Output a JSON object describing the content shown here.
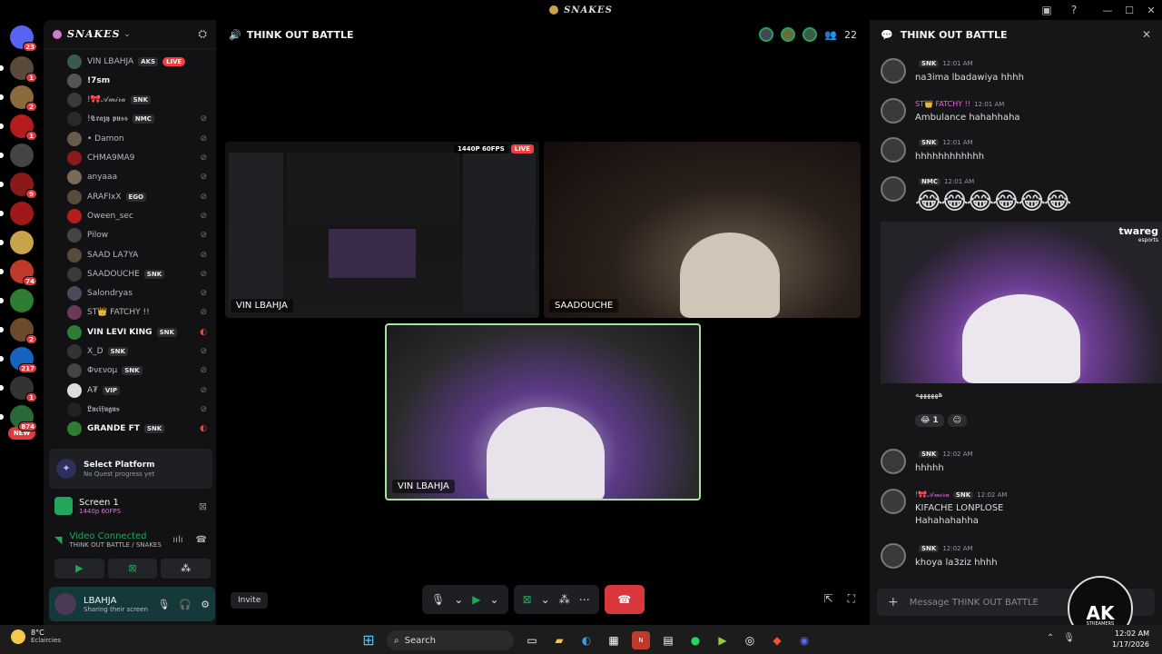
{
  "window": {
    "title": "SNAKES"
  },
  "rail": {
    "home_badge": "23",
    "servers": [
      {
        "color": "#5a4a3a",
        "badge": "1"
      },
      {
        "color": "#8a6a3a",
        "badge": "2"
      },
      {
        "color": "#b71c1c",
        "badge": "1"
      },
      {
        "color": "#444444",
        "badge": ""
      },
      {
        "color": "#8a1a1a",
        "badge": "9"
      },
      {
        "color": "#a01818",
        "badge": ""
      },
      {
        "color": "#c9a34a",
        "badge": ""
      },
      {
        "color": "#c0392b",
        "badge": "74"
      },
      {
        "color": "#2e7d32",
        "badge": ""
      },
      {
        "color": "#6a4a2a",
        "badge": "2"
      },
      {
        "color": "#1565c0",
        "badge": "217"
      },
      {
        "color": "#333333",
        "badge": "1"
      },
      {
        "color": "#2a6a3a",
        "badge": "874"
      }
    ],
    "new_label": "NEW"
  },
  "sidebar": {
    "server_name": "SNAKES",
    "members": [
      {
        "name": "VIN LBAHJA",
        "tag": "AKS",
        "live": "LIVE",
        "hi": false,
        "muted": false,
        "red": false,
        "avatar": "#3a5a4a"
      },
      {
        "name": "!7sm",
        "tag": "",
        "live": "",
        "hi": true,
        "muted": false,
        "red": false,
        "avatar": "#555555"
      },
      {
        "name": "!🎀𝒜𝓂𝒾𝓇𝒶",
        "tag": "SNK",
        "live": "",
        "hi": false,
        "muted": false,
        "red": false,
        "avatar": "#3a3a3a"
      },
      {
        "name": "!𝕮𝖗𝖆𝖟𝖞 𝖕𝖚𝖘𝖘",
        "tag": "NMC",
        "live": "",
        "hi": false,
        "muted": true,
        "red": false,
        "avatar": "#2a2a2a"
      },
      {
        "name": "• Damon",
        "tag": "",
        "live": "",
        "hi": false,
        "muted": true,
        "red": false,
        "avatar": "#6a5a4a"
      },
      {
        "name": "CHMA9MA9",
        "tag": "",
        "live": "",
        "hi": false,
        "muted": true,
        "red": false,
        "avatar": "#8a1a1a"
      },
      {
        "name": "anyaaa",
        "tag": "",
        "live": "",
        "hi": false,
        "muted": true,
        "red": false,
        "avatar": "#7a6a5a"
      },
      {
        "name": "ARAFIxX",
        "tag": "EGO",
        "live": "",
        "hi": false,
        "muted": true,
        "red": false,
        "avatar": "#5a4a3a"
      },
      {
        "name": "Oween_sec",
        "tag": "",
        "live": "",
        "hi": false,
        "muted": true,
        "red": false,
        "avatar": "#b71c1c"
      },
      {
        "name": "Pilow",
        "tag": "",
        "live": "",
        "hi": false,
        "muted": true,
        "red": false,
        "avatar": "#444444"
      },
      {
        "name": "SAAD LA7YA",
        "tag": "",
        "live": "",
        "hi": false,
        "muted": true,
        "red": false,
        "avatar": "#5a4a3a"
      },
      {
        "name": "SAADOUCHE",
        "tag": "SNK",
        "live": "",
        "hi": false,
        "muted": true,
        "red": false,
        "avatar": "#3a3a3a"
      },
      {
        "name": "Salondryas",
        "tag": "",
        "live": "",
        "hi": false,
        "muted": true,
        "red": false,
        "avatar": "#4a4a5a"
      },
      {
        "name": "ST👑 FATCHY !!",
        "tag": "",
        "live": "",
        "hi": false,
        "muted": true,
        "red": false,
        "avatar": "#6a3a5a"
      },
      {
        "name": "VIN LEVI KING",
        "tag": "SNK",
        "live": "",
        "hi": true,
        "muted": true,
        "red": true,
        "avatar": "#2e7d32"
      },
      {
        "name": "X_D",
        "tag": "SNK",
        "live": "",
        "hi": false,
        "muted": true,
        "red": false,
        "avatar": "#333333"
      },
      {
        "name": "Φνενομ",
        "tag": "SNK",
        "live": "",
        "hi": false,
        "muted": true,
        "red": false,
        "avatar": "#444444"
      },
      {
        "name": "A₮",
        "tag": "VIP",
        "live": "",
        "hi": false,
        "muted": true,
        "red": false,
        "avatar": "#dddddd"
      },
      {
        "name": "𝕷𝖚𝖈𝖎𝖋𝖚𝖌𝖚𝖘",
        "tag": "",
        "live": "",
        "hi": false,
        "muted": true,
        "red": false,
        "avatar": "#222222"
      },
      {
        "name": "GRANDE FT",
        "tag": "SNK",
        "live": "",
        "hi": true,
        "muted": true,
        "red": true,
        "avatar": "#2e7d32"
      }
    ],
    "quest": {
      "title": "Select Platform",
      "subtitle": "No Quest progress yet"
    },
    "stream": {
      "title": "Screen 1",
      "quality": "1440p 60FPS"
    },
    "voice": {
      "status": "Video Connected",
      "channel": "THINK OUT BATTLE / SNAKES"
    },
    "user": {
      "name": "LBAHJA",
      "status": "Sharing their screen"
    }
  },
  "call": {
    "channel": "THINK OUT BATTLE",
    "participant_count": "22",
    "tiles": {
      "screen_label": "VIN LBAHJA",
      "screen_quality": "1440P 60FPS",
      "screen_live": "LIVE",
      "saad_label": "SAADOUCHE",
      "vin_label": "VIN LBAHJA"
    },
    "invite_label": "Invite"
  },
  "chat": {
    "title": "THINK OUT BATTLE",
    "messages": [
      {
        "user": "",
        "tag": "SNK",
        "time": "12:01 AM",
        "text": "na3ima lbadawiya hhhh",
        "color": "r"
      },
      {
        "user": "ST👑 FATCHY !!",
        "tag": "",
        "time": "12:01 AM",
        "text": "Ambulance hahahhaha",
        "color": "p"
      },
      {
        "user": "",
        "tag": "SNK",
        "time": "12:01 AM",
        "text": "hhhhhhhhhhhh",
        "color": "r"
      },
      {
        "user": "",
        "tag": "NMC",
        "time": "12:01 AM",
        "text": "",
        "color": "b"
      },
      {
        "user": "",
        "tag": "SNK",
        "time": "12:02 AM",
        "text": "hhhhh",
        "color": "r"
      },
      {
        "user": "!🎀𝒜𝓂𝒾𝓇𝒶",
        "tag": "SNK",
        "time": "12:02 AM",
        "text": "KIFACHE LONPLOSE",
        "text2": "Hahahahahha",
        "color": "p"
      },
      {
        "user": "",
        "tag": "SNK",
        "time": "12:02 AM",
        "text": "khoya la3ziz hhhh",
        "color": "r"
      }
    ],
    "emoji_line": "😂😂😂😂😂😂",
    "embed_brand": "twareg",
    "embed_sub": "esports",
    "garbled_line": "ههههههه",
    "reaction_count": "1",
    "composer_placeholder": "Message THINK OUT BATTLE"
  },
  "ak_badge": {
    "line1": "AK",
    "line2": "STREAMERS"
  },
  "taskbar": {
    "temp": "8°C",
    "weather": "Eclaircies",
    "search_label": "Search",
    "time": "12:02 AM",
    "date": "1/17/2026"
  }
}
